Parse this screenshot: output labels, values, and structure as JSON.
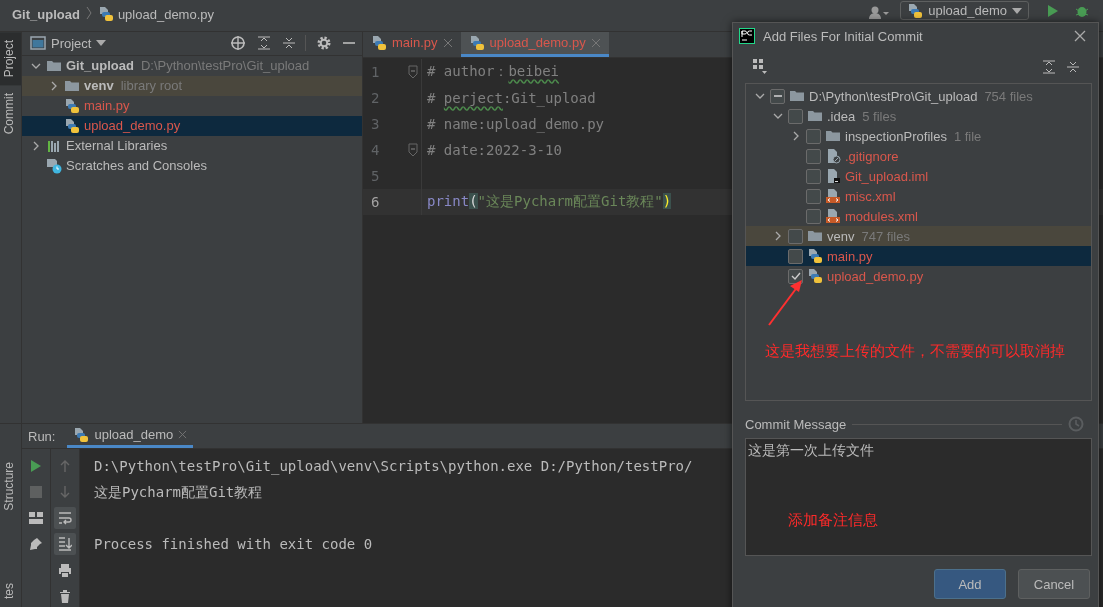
{
  "breadcrumbs": [
    "Git_upload",
    "upload_demo.py"
  ],
  "run_config": "upload_demo",
  "side_tabs": [
    {
      "label": "Project",
      "selected": true
    },
    {
      "label": "Commit",
      "selected": false
    }
  ],
  "bottom_side_tabs": [
    "Structure",
    "tes"
  ],
  "project": {
    "title": "Project",
    "tree": [
      {
        "name": "Git_upload",
        "hint": "D:\\Python\\testPro\\Git_upload",
        "kind": "folder",
        "expanded": true,
        "selected": false,
        "unversioned": false,
        "children": [
          {
            "name": "venv",
            "hint": "library root",
            "kind": "library-root",
            "expanded": false,
            "selected": false,
            "unversioned": false
          },
          {
            "name": "main.py",
            "kind": "python",
            "selected": false,
            "unversioned": true
          },
          {
            "name": "upload_demo.py",
            "kind": "python",
            "selected": true,
            "unversioned": true
          }
        ]
      },
      {
        "name": "External Libraries",
        "kind": "libraries",
        "expanded": false,
        "selected": false,
        "unversioned": false
      },
      {
        "name": "Scratches and Consoles",
        "kind": "scratches",
        "selected": false,
        "unversioned": false
      }
    ]
  },
  "editor": {
    "tabs": [
      {
        "label": "main.py",
        "selected": false
      },
      {
        "label": "upload_demo.py",
        "selected": true
      }
    ],
    "lines": [
      {
        "number": "1",
        "fold": true,
        "current": false,
        "parts": [
          {
            "text": "# author：",
            "kind": "comment",
            "typo": false
          },
          {
            "text": "beibei",
            "kind": "comment",
            "typo": true
          }
        ]
      },
      {
        "number": "2",
        "fold": false,
        "current": false,
        "parts": [
          {
            "text": "# ",
            "kind": "comment",
            "typo": false
          },
          {
            "text": "perject",
            "kind": "comment",
            "typo": true
          },
          {
            "text": ":Git_upload",
            "kind": "comment",
            "typo": false
          }
        ]
      },
      {
        "number": "3",
        "fold": false,
        "current": false,
        "parts": [
          {
            "text": "# name:upload_demo.py",
            "kind": "comment",
            "typo": false
          }
        ]
      },
      {
        "number": "4",
        "fold": true,
        "current": false,
        "parts": [
          {
            "text": "# date:2022-3-10",
            "kind": "comment",
            "typo": false
          }
        ]
      },
      {
        "number": "5",
        "fold": false,
        "current": false
      },
      {
        "number": "6",
        "fold": false,
        "current": true,
        "parts": [
          {
            "text": "print",
            "kind": "builtin",
            "typo": false
          },
          {
            "text": "(",
            "kind": "paren",
            "typo": false
          },
          {
            "text": "\"这是Pycharm配置Git教程\"",
            "kind": "string",
            "typo": false
          },
          {
            "text": ")",
            "kind": "paren-hl",
            "typo": false
          }
        ]
      }
    ]
  },
  "run_panel": {
    "label": "Run:",
    "tab": "upload_demo",
    "tools": [
      {
        "kind": "up",
        "on": false
      },
      {
        "kind": "down",
        "on": false
      },
      {
        "kind": "wrap",
        "on": true
      },
      {
        "kind": "scroll",
        "on": true
      },
      {
        "kind": "print",
        "on": false
      },
      {
        "kind": "trash",
        "on": false
      }
    ],
    "console": [
      {
        "text": "D:\\Python\\testPro\\Git_upload\\venv\\Scripts\\python.exe D:/Python/testPro/",
        "kind": "command"
      },
      {
        "text": "这是Pycharm配置Git教程",
        "kind": "output"
      },
      {
        "text": "Process finished with exit code 0",
        "kind": "status"
      }
    ]
  },
  "dialog": {
    "title": "Add Files For Initial Commit",
    "tree": [
      {
        "name": "D:\\Python\\testPro\\Git_upload",
        "count": "754 files",
        "kind": "folder",
        "expanded": true,
        "checked": false,
        "partial": true,
        "selected": false,
        "unversioned": false,
        "children": [
          {
            "name": ".idea",
            "count": "5 files",
            "kind": "folder",
            "expanded": true,
            "checked": false,
            "partial": false,
            "selected": false,
            "unversioned": false,
            "children": [
              {
                "name": "inspectionProfiles",
                "count": "1 file",
                "kind": "folder",
                "expanded": false,
                "checked": false,
                "partial": false,
                "selected": false,
                "unversioned": false
              },
              {
                "name": ".gitignore",
                "kind": "gitignore",
                "checked": false,
                "partial": false,
                "selected": false,
                "unversioned": true
              },
              {
                "name": "Git_upload.iml",
                "kind": "iml",
                "checked": false,
                "partial": false,
                "selected": false,
                "unversioned": true
              },
              {
                "name": "misc.xml",
                "kind": "xml",
                "checked": false,
                "partial": false,
                "selected": false,
                "unversioned": true
              },
              {
                "name": "modules.xml",
                "kind": "xml",
                "checked": false,
                "partial": false,
                "selected": false,
                "unversioned": true
              }
            ]
          },
          {
            "name": "venv",
            "count": "747 files",
            "kind": "library-root",
            "expanded": false,
            "checked": false,
            "partial": false,
            "selected": false,
            "unversioned": false
          },
          {
            "name": "main.py",
            "kind": "python",
            "checked": false,
            "partial": false,
            "selected": true,
            "unversioned": true
          },
          {
            "name": "upload_demo.py",
            "kind": "python",
            "checked": true,
            "partial": false,
            "selected": false,
            "unversioned": true
          }
        ]
      }
    ],
    "annotations": [
      {
        "text": "这是我想要上传的文件，不需要的可以取消掉"
      },
      {
        "text": "添加备注信息"
      }
    ],
    "commit_label": "Commit Message",
    "commit_message": "这是第一次上传文件",
    "buttons": [
      {
        "label": "Add",
        "kind": "primary"
      },
      {
        "label": "Cancel",
        "kind": "secondary"
      }
    ]
  }
}
